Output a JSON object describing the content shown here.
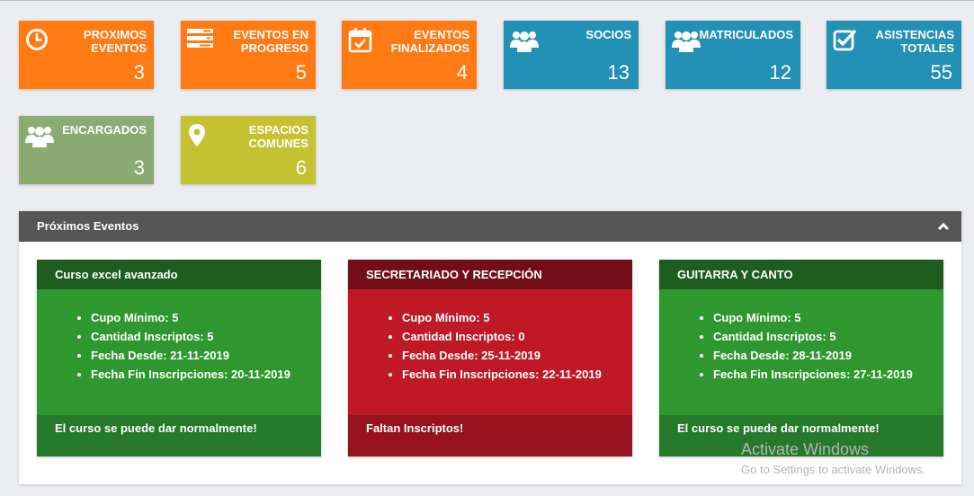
{
  "tiles": [
    {
      "label": "PROXIMOS EVENTOS",
      "value": "3",
      "color": "#ff7a13",
      "icon": "clock-icon"
    },
    {
      "label": "EVENTOS EN PROGRESO",
      "value": "5",
      "color": "#ff7a13",
      "icon": "tasks-icon"
    },
    {
      "label": "EVENTOS FINALIZADOS",
      "value": "4",
      "color": "#ff7a13",
      "icon": "calendar-check-icon"
    },
    {
      "label": "SOCIOS",
      "value": "13",
      "color": "#2390b5",
      "icon": "users-icon"
    },
    {
      "label": "MATRICULADOS",
      "value": "12",
      "color": "#2390b5",
      "icon": "users-icon"
    },
    {
      "label": "ASISTENCIAS TOTALES",
      "value": "55",
      "color": "#2390b5",
      "icon": "checkbox-icon"
    },
    {
      "label": "ENCARGADOS",
      "value": "3",
      "color": "#8aab72",
      "icon": "users-icon"
    },
    {
      "label": "ESPACIOS COMUNES",
      "value": "6",
      "color": "#c4c231",
      "icon": "map-marker-icon"
    }
  ],
  "panel": {
    "title": "Próximos Eventos"
  },
  "events": [
    {
      "title": "Curso excel avanzado",
      "theme": "green",
      "items": [
        "Cupo Mínimo: 5",
        "Cantidad Inscriptos: 5",
        "Fecha Desde: 21-11-2019",
        "Fecha Fin Inscripciones: 20-11-2019"
      ],
      "footer": "El curso se puede dar normalmente!"
    },
    {
      "title": "SECRETARIADO Y RECEPCIÓN",
      "theme": "red",
      "items": [
        "Cupo Mínimo: 5",
        "Cantidad Inscriptos: 0",
        "Fecha Desde: 25-11-2019",
        "Fecha Fin Inscripciones: 22-11-2019"
      ],
      "footer": "Faltan Inscriptos!"
    },
    {
      "title": "GUITARRA Y CANTO",
      "theme": "green",
      "items": [
        "Cupo Mínimo: 5",
        "Cantidad Inscriptos: 5",
        "Fecha Desde: 28-11-2019",
        "Fecha Fin Inscripciones: 27-11-2019"
      ],
      "footer": "El curso se puede dar normalmente!"
    }
  ],
  "watermark": {
    "line1": "Activate Windows",
    "line2": "Go to Settings to activate Windows."
  }
}
